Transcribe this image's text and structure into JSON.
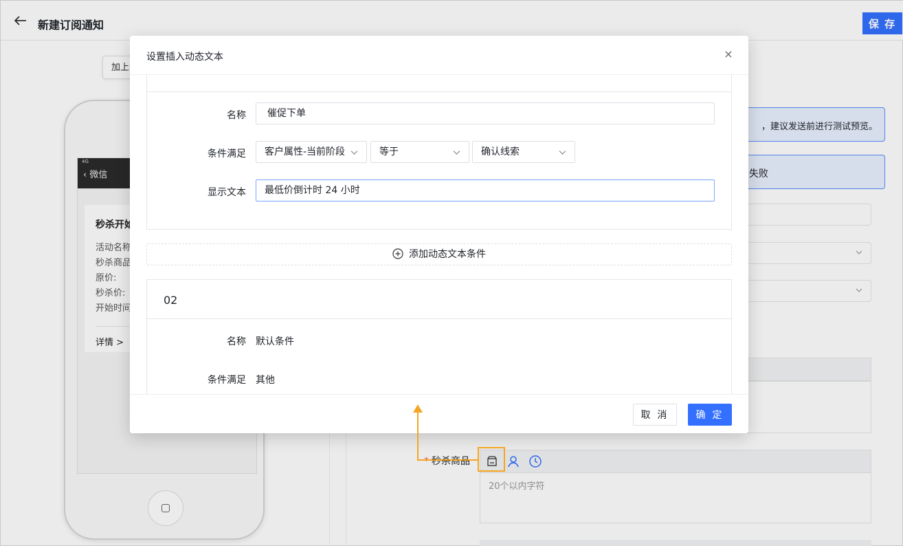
{
  "page": {
    "title": "新建订阅通知",
    "save_label": "保 存",
    "tag_button": "加上参"
  },
  "phone": {
    "status": "4G",
    "nav_back_label": "微信",
    "card_title": "秒杀开始",
    "lines": [
      "活动名称",
      "秒杀商品",
      "原价:",
      "秒杀价:",
      "开始时间"
    ],
    "detail_label": "详情 >"
  },
  "right_panel": {
    "notice1": "，建议发送前进行测试预览。",
    "notice2": "失败",
    "goods_field": {
      "label": "秒杀商品",
      "placeholder": "20个以内字符"
    }
  },
  "modal": {
    "title": "设置插入动态文本",
    "close_icon": "close-icon",
    "condition1": {
      "name_label": "名称",
      "name_value": "催促下单",
      "condition_label": "条件满足",
      "attribute_select": "客户属性-当前阶段",
      "operator_select": "等于",
      "value_select": "确认线索",
      "display_label": "显示文本",
      "display_value": "最低价倒计时 24 小时"
    },
    "add_condition_label": "添加动态文本条件",
    "condition2": {
      "number": "02",
      "name_label": "名称",
      "name_value": "默认条件",
      "condition_label": "条件满足",
      "condition_value": "其他"
    },
    "cancel_label": "取 消",
    "ok_label": "确 定"
  },
  "colors": {
    "primary": "#3370ff",
    "highlight": "#f5a623",
    "danger": "#f54a45"
  }
}
